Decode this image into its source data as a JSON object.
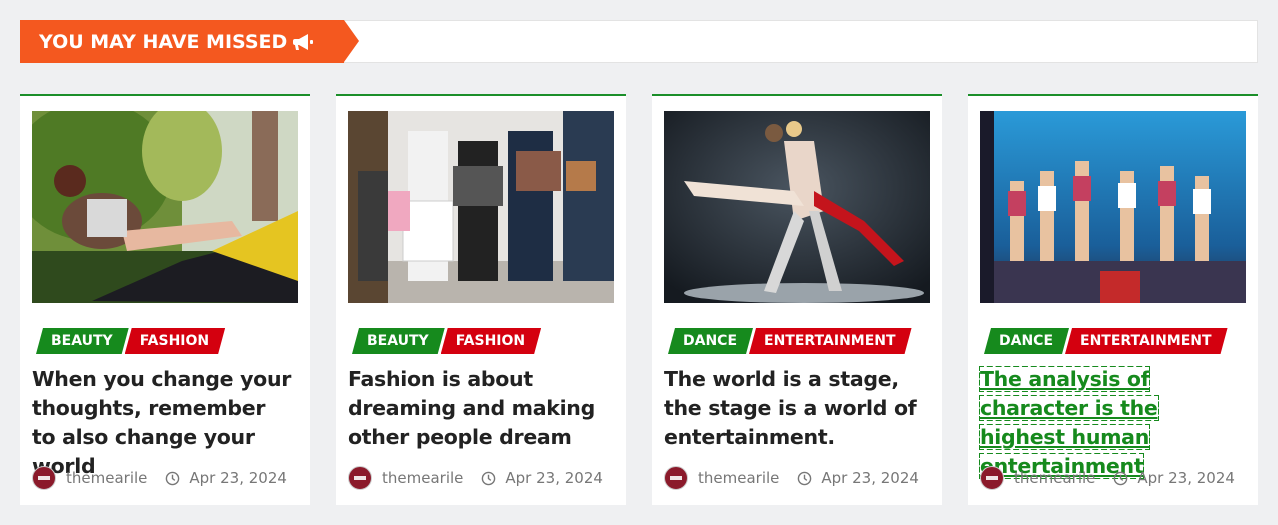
{
  "section": {
    "title": "YOU MAY HAVE MISSED",
    "icon": "megaphone-icon",
    "accent": "#f4581f"
  },
  "colors": {
    "green": "#168a1d",
    "red": "#d4000f",
    "card_border": "#1b8f2a"
  },
  "posts": [
    {
      "image": "woman-on-motorcycle-photo",
      "cat1": "BEAUTY",
      "cat2": "FASHION",
      "title": "When you change your thoughts, remember to also change your world",
      "author": "themearile",
      "date": "Apr 23, 2024"
    },
    {
      "image": "shoppers-with-bags-photo",
      "cat1": "BEAUTY",
      "cat2": "FASHION",
      "title": "Fashion is about dreaming and making other people dream",
      "author": "themearile",
      "date": "Apr 23, 2024"
    },
    {
      "image": "ballet-dancers-photo",
      "cat1": "DANCE",
      "cat2": "ENTERTAINMENT",
      "title": "The world is a stage, the stage is a world of entertainment.",
      "author": "themearile",
      "date": "Apr 23, 2024"
    },
    {
      "image": "stage-dance-group-photo",
      "cat1": "DANCE",
      "cat2": "ENTERTAINMENT",
      "title": "The analysis of character is the highest human entertainment",
      "author": "themearile",
      "date": "Apr 23, 2024"
    }
  ]
}
